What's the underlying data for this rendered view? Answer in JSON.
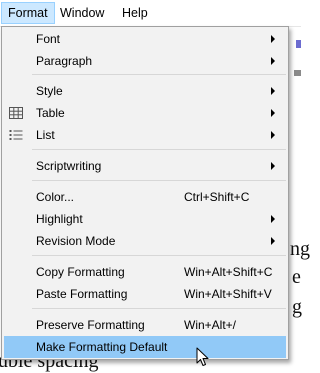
{
  "menubar": {
    "items": [
      {
        "label": "Format",
        "active": true
      },
      {
        "label": "Window",
        "active": false
      },
      {
        "label": "Help",
        "active": false
      }
    ]
  },
  "background_text": {
    "fragments": [
      "ng",
      "e",
      "g",
      "uble spacing"
    ]
  },
  "format_menu": {
    "font": {
      "label": "Font"
    },
    "paragraph": {
      "label": "Paragraph"
    },
    "style": {
      "label": "Style"
    },
    "table": {
      "label": "Table",
      "icon": "table-grid-icon"
    },
    "list": {
      "label": "List",
      "icon": "bulleted-list-icon"
    },
    "scriptwriting": {
      "label": "Scriptwriting"
    },
    "color": {
      "label": "Color...",
      "shortcut": "Ctrl+Shift+C"
    },
    "highlight": {
      "label": "Highlight"
    },
    "revision_mode": {
      "label": "Revision Mode"
    },
    "copy_formatting": {
      "label": "Copy Formatting",
      "shortcut": "Win+Alt+Shift+C"
    },
    "paste_formatting": {
      "label": "Paste Formatting",
      "shortcut": "Win+Alt+Shift+V"
    },
    "preserve_formatting": {
      "label": "Preserve Formatting",
      "shortcut": "Win+Alt+/"
    },
    "make_formatting_default": {
      "label": "Make Formatting Default",
      "highlighted": true
    }
  },
  "colors": {
    "menubar_active_bg": "#cce8ff",
    "menu_bg": "#f2f2f2",
    "highlight_bg": "#91c9f7"
  }
}
